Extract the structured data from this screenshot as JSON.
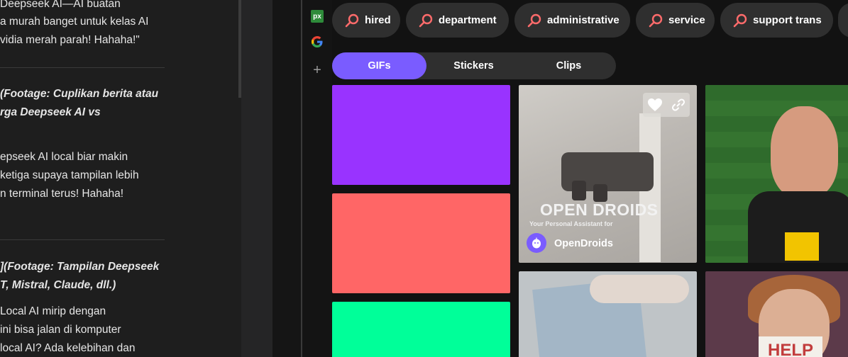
{
  "article": {
    "paragraphs": [
      {
        "lines": [
          "Deepseek AI—AI buatan",
          "a murah banget untuk kelas AI",
          "vidia merah parah! Hahaha!\""
        ],
        "italic": false
      },
      {
        "lines": [
          "(Footage: Cuplikan berita atau",
          "rga Deepseek AI vs"
        ],
        "italic": true
      },
      {
        "lines": [
          "epseek AI local biar makin",
          " ketiga supaya tampilan lebih",
          "n terminal terus! Hahaha!"
        ],
        "italic": false
      },
      {
        "lines": [
          "](Footage: Tampilan Deepseek",
          "T, Mistral, Claude, dll.)"
        ],
        "italic": true
      },
      {
        "lines": [
          " Local AI mirip dengan",
          "ini bisa jalan di komputer",
          "local AI? Ada kelebihan dan"
        ],
        "italic": false
      }
    ]
  },
  "rail": {
    "items": [
      {
        "name": "pixabay-icon",
        "glyph": "px"
      },
      {
        "name": "google-icon",
        "glyph": "G"
      },
      {
        "name": "add-icon",
        "glyph": "+"
      }
    ]
  },
  "search_chips": [
    {
      "label": "hired"
    },
    {
      "label": "department"
    },
    {
      "label": "administrative"
    },
    {
      "label": "service"
    },
    {
      "label": "support trans"
    }
  ],
  "tabs": [
    {
      "label": "GIFs",
      "active": true
    },
    {
      "label": "Stickers",
      "active": false
    },
    {
      "label": "Clips",
      "active": false
    }
  ],
  "results": {
    "tile_colors": [
      "#9933ff",
      "#ff6666",
      "#00ff99"
    ],
    "featured": {
      "title": "OPEN DROIDS",
      "tagline": "Your Personal Assistant for",
      "owner": "OpenDroids"
    },
    "sign_text": "HELP"
  },
  "colors": {
    "accent": "#7a5cff",
    "chip_bg": "#2f2f2f",
    "search_icon": "#ff6b6b"
  }
}
